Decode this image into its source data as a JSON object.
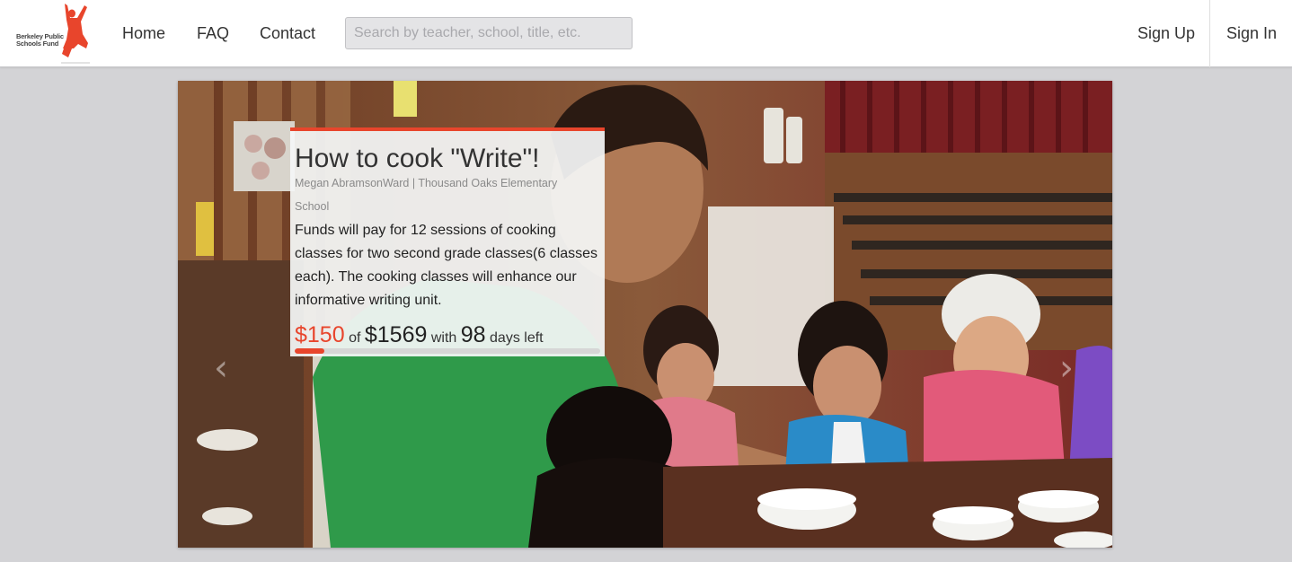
{
  "brand": {
    "logo_line1": "Berkeley Public",
    "logo_line2": "Schools Fund",
    "accent_color": "#e8452c"
  },
  "nav": {
    "home": "Home",
    "faq": "FAQ",
    "contact": "Contact",
    "search_placeholder": "Search by teacher, school, title, etc.",
    "sign_up": "Sign Up",
    "sign_in": "Sign In"
  },
  "carousel": {
    "prev_glyph": "‹",
    "next_glyph": "›"
  },
  "project": {
    "title": "How to cook \"Write\"!",
    "meta": "Megan AbramsonWard | Thousand Oaks Elementary School",
    "description": "Funds will pay for 12 sessions of cooking classes for two second grade classes(6 classes each). The cooking classes will enhance our informative writing unit.",
    "raised": "$150",
    "of_label": "of",
    "goal": "$1569",
    "with_label": "with",
    "days": "98",
    "days_label": "days left",
    "progress_fraction": 0.096
  }
}
